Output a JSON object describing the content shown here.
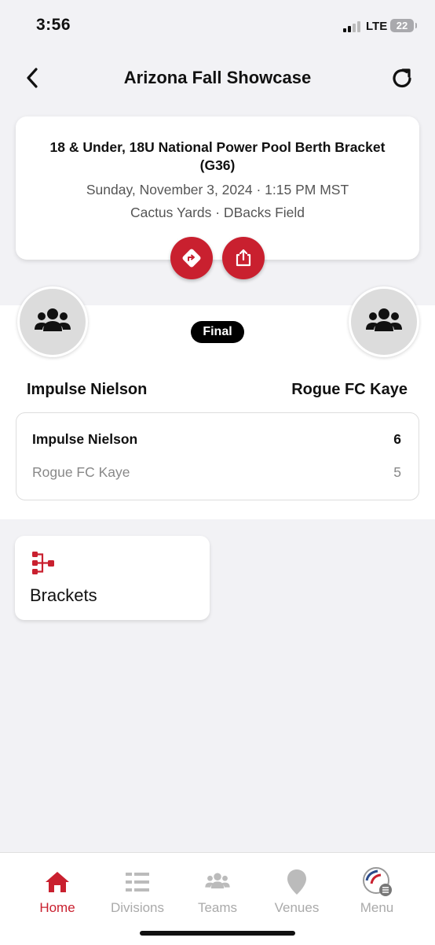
{
  "status_bar": {
    "time": "3:56",
    "network": "LTE",
    "battery": "22"
  },
  "header": {
    "title": "Arizona Fall Showcase"
  },
  "game": {
    "title": "18 & Under, 18U National Power Pool Berth Bracket (G36)",
    "datetime": "Sunday, November 3, 2024 · 1:15 PM MST",
    "venue": "Cactus Yards · DBacks Field"
  },
  "matchup": {
    "status": "Final",
    "home_team": "Impulse Nielson",
    "away_team": "Rogue FC Kaye",
    "scores": [
      {
        "team": "Impulse Nielson",
        "score": "6"
      },
      {
        "team": "Rogue FC Kaye",
        "score": "5"
      }
    ]
  },
  "tiles": {
    "brackets_label": "Brackets"
  },
  "colors": {
    "accent": "#c9202f",
    "background": "#f2f2f5",
    "badge": "#000000"
  },
  "tabbar": {
    "tabs": [
      {
        "label": "Home",
        "icon": "home-icon",
        "active": true
      },
      {
        "label": "Divisions",
        "icon": "divisions-icon",
        "active": false
      },
      {
        "label": "Teams",
        "icon": "teams-icon",
        "active": false
      },
      {
        "label": "Venues",
        "icon": "venues-icon",
        "active": false
      },
      {
        "label": "Menu",
        "icon": "menu-icon",
        "active": false
      }
    ]
  }
}
